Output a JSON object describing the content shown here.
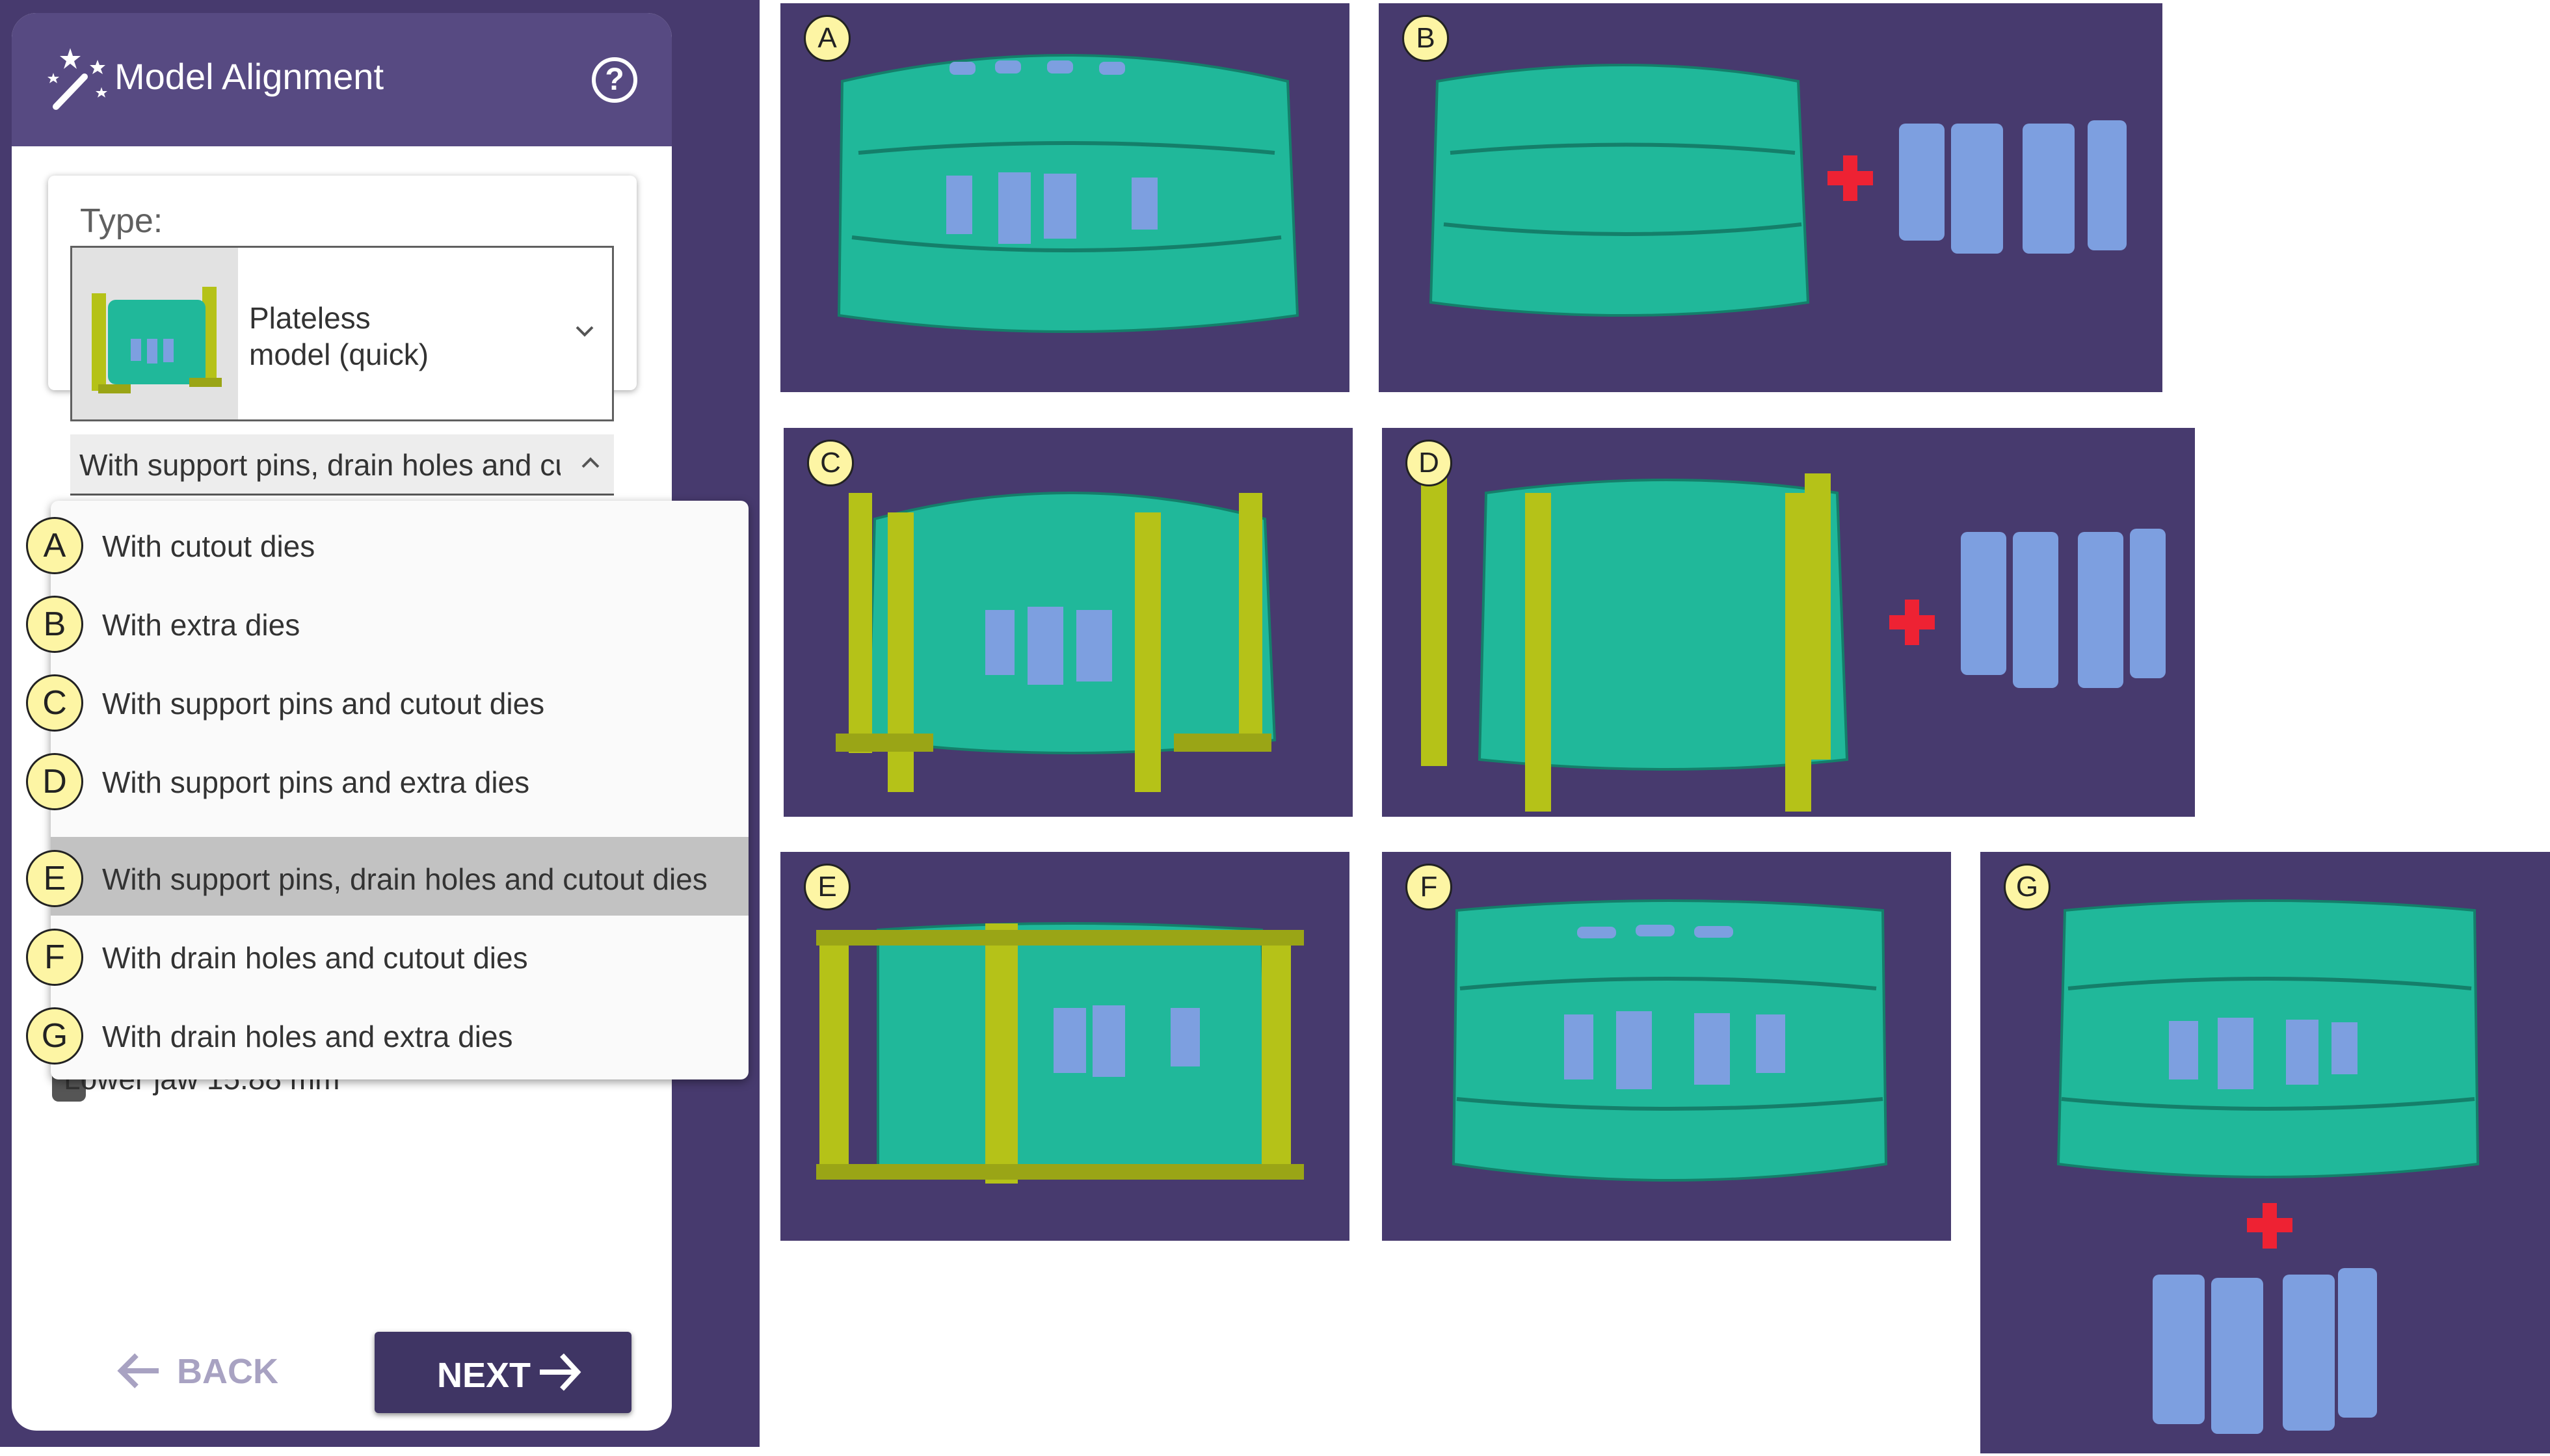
{
  "panel": {
    "title": "Model Alignment",
    "help_icon": "help-circle-icon",
    "wand_icon": "magic-wand-icon",
    "type_label": "Type:",
    "type_value": "Plateless\nmodel (quick)",
    "sub_value": "With support pins, drain holes and cutout dies",
    "hidden_row_text": "Lower jaw 15.88 mm",
    "back_label": "BACK",
    "next_label": "NEXT"
  },
  "dropdown": {
    "items": [
      {
        "letter": "A",
        "label": "With cutout dies"
      },
      {
        "letter": "B",
        "label": "With extra dies"
      },
      {
        "letter": "C",
        "label": "With support pins and cutout dies"
      },
      {
        "letter": "D",
        "label": "With support pins and extra dies"
      },
      {
        "letter": "E",
        "label": "With support pins, drain holes and cutout dies"
      },
      {
        "letter": "F",
        "label": "With drain holes and cutout dies"
      },
      {
        "letter": "G",
        "label": "With drain holes and extra dies"
      }
    ],
    "selected": "E"
  },
  "previews": [
    {
      "letter": "A"
    },
    {
      "letter": "B"
    },
    {
      "letter": "C"
    },
    {
      "letter": "D"
    },
    {
      "letter": "E"
    },
    {
      "letter": "F"
    },
    {
      "letter": "G"
    }
  ],
  "colors": {
    "purple_bg": "#473a6e",
    "header": "#574a82",
    "model_green": "#20b89a",
    "die_blue": "#7d9fe0",
    "pin_yellow": "#b5c218",
    "plus_red": "#ee2233",
    "badge_yellow": "#fdf5a4"
  }
}
